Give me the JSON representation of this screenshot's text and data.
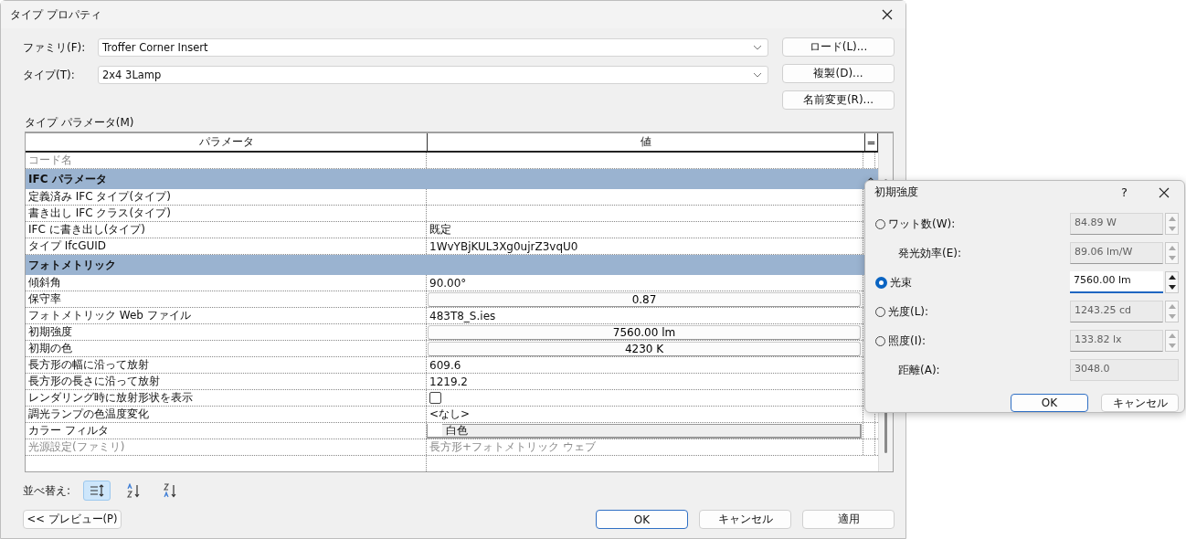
{
  "window": {
    "title": "タイプ プロパティ"
  },
  "family": {
    "label": "ファミリ(F):",
    "value": "Troffer Corner Insert"
  },
  "type": {
    "label": "タイプ(T):",
    "value": "2x4 3Lamp"
  },
  "side_buttons": [
    "ロード(L)...",
    "複製(D)...",
    "名前変更(R)..."
  ],
  "params_label": "タイプ パラメータ(M)",
  "table": {
    "columns": [
      "パラメータ",
      "値",
      "="
    ],
    "rows": [
      {
        "kind": "text",
        "name": "コード名",
        "disabled": true
      },
      {
        "kind": "group",
        "name": "IFC パラメータ",
        "expanded": true
      },
      {
        "kind": "text",
        "name": "定義済み IFC タイプ(タイプ)",
        "disabled": false
      },
      {
        "kind": "text",
        "name": "書き出し IFC クラス(タイプ)",
        "disabled": false
      },
      {
        "kind": "text",
        "name": "IFC に書き出し(タイプ)",
        "value": "既定",
        "disabled": false
      },
      {
        "kind": "text",
        "name": "タイプ IfcGUID",
        "value": "1WvYBjKUL3Xg0ujrZ3vqU0",
        "disabled": false
      },
      {
        "kind": "group",
        "name": "フォトメトリック"
      },
      {
        "kind": "text",
        "name": "傾斜角",
        "value": "90.00°",
        "disabled": false
      },
      {
        "kind": "button",
        "name": "保守率",
        "value": "0.87",
        "disabled": false
      },
      {
        "kind": "text",
        "name": "フォトメトリック Web ファイル",
        "value": "483T8_S.ies",
        "disabled": false
      },
      {
        "kind": "button",
        "name": "初期強度",
        "value": "7560.00 lm",
        "disabled": false
      },
      {
        "kind": "button",
        "name": "初期の色",
        "value": "4230 K",
        "disabled": false
      },
      {
        "kind": "text",
        "name": "長方形の幅に沿って放射",
        "value": "609.6",
        "disabled": false
      },
      {
        "kind": "text",
        "name": "長方形の長さに沿って放射",
        "value": "1219.2",
        "disabled": false
      },
      {
        "kind": "checkbox",
        "name": "レンダリング時に放射形状を表示",
        "checked": false,
        "disabled": false
      },
      {
        "kind": "text",
        "name": "調光ランプの色温度変化",
        "value": "<なし>",
        "disabled": false
      },
      {
        "kind": "color",
        "name": "カラー フィルタ",
        "value": "白色",
        "color": "#ffffff",
        "disabled": false
      },
      {
        "kind": "text",
        "name": "光源設定(ファミリ)",
        "value": "長方形+フォトメトリック ウェブ",
        "disabled": true
      }
    ]
  },
  "sort": {
    "label": "並べ替え:",
    "options": [
      {
        "kind": "grouped",
        "selected": true
      },
      {
        "kind": "ascending",
        "selected": false
      },
      {
        "kind": "descending",
        "selected": false
      }
    ]
  },
  "preview_button": "<< プレビュー(P)",
  "footer_buttons": [
    {
      "label": "OK",
      "default": true
    },
    {
      "label": "キャンセル",
      "default": false
    },
    {
      "label": "適用",
      "default": false
    }
  ],
  "popup": {
    "title": "初期強度",
    "help": "?",
    "options": [
      {
        "kind": "radio",
        "label": "ワット数(W):",
        "selected": false,
        "value": "84.89 W",
        "disabled": true,
        "spinner": true
      },
      {
        "kind": "label",
        "label": "発光効率(E):",
        "value": "89.06 lm/W",
        "disabled": true,
        "spinner": true
      },
      {
        "kind": "radio",
        "label": "光束",
        "selected": true,
        "value": "7560.00 lm",
        "disabled": false,
        "spinner": true
      },
      {
        "kind": "radio",
        "label": "光度(L):",
        "selected": false,
        "value": "1243.25 cd",
        "disabled": true,
        "spinner": true
      },
      {
        "kind": "radio",
        "label": "照度(I):",
        "selected": false,
        "value": "133.82 lx",
        "disabled": true,
        "spinner": true
      },
      {
        "kind": "label",
        "label": "距離(A):",
        "value": "3048.0",
        "disabled": true,
        "spinner": false
      }
    ],
    "buttons": [
      {
        "label": "OK",
        "default": true
      },
      {
        "label": "キャンセル",
        "default": false
      }
    ]
  }
}
